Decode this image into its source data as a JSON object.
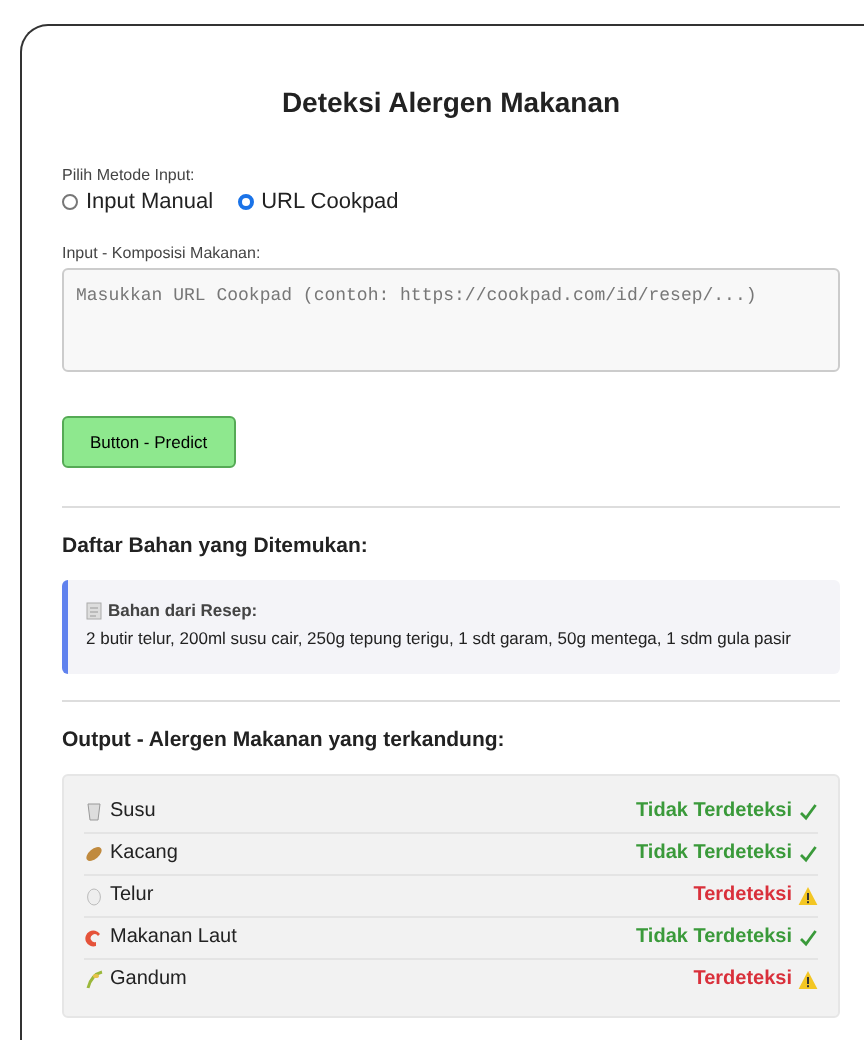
{
  "title": "Deteksi Alergen Makanan",
  "method": {
    "label": "Pilih Metode Input:",
    "options": [
      {
        "label": "Input Manual",
        "selected": false
      },
      {
        "label": "URL Cookpad",
        "selected": true
      }
    ]
  },
  "input": {
    "label": "Input - Komposisi Makanan:",
    "placeholder": "Masukkan URL Cookpad (contoh: https://cookpad.com/id/resep/...)"
  },
  "button": "Button - Predict",
  "ingredients": {
    "heading": "Daftar Bahan yang Ditemukan:",
    "title": "Bahan dari Resep:",
    "text": "2 butir telur, 200ml susu cair, 250g tepung terigu, 1 sdt garam, 50g mentega, 1 sdm gula pasir"
  },
  "output": {
    "heading": "Output - Alergen Makanan yang terkandung:",
    "allergens": [
      {
        "name": "Susu",
        "kind": "milk",
        "detected": false,
        "status": "Tidak Terdeteksi"
      },
      {
        "name": "Kacang",
        "kind": "peanut",
        "detected": false,
        "status": "Tidak Terdeteksi"
      },
      {
        "name": "Telur",
        "kind": "egg",
        "detected": true,
        "status": "Terdeteksi"
      },
      {
        "name": "Makanan Laut",
        "kind": "shrimp",
        "detected": false,
        "status": "Tidak Terdeteksi"
      },
      {
        "name": "Gandum",
        "kind": "wheat",
        "detected": true,
        "status": "Terdeteksi"
      }
    ]
  }
}
